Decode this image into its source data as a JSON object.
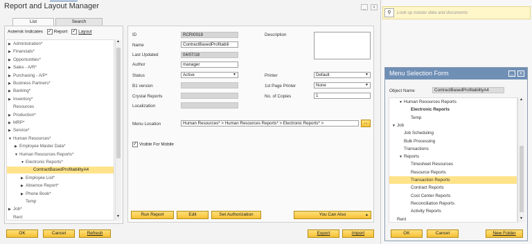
{
  "window": {
    "title": "Report and Layout Manager",
    "minimize": "_",
    "close": "x"
  },
  "tabs": [
    {
      "label": "List"
    },
    {
      "label": "Search"
    }
  ],
  "filter": {
    "label": "Asterisk Indicates",
    "report": "Report",
    "layout": "Layout"
  },
  "tree": [
    {
      "label": "Administration*",
      "level": 0,
      "arrow": "▶"
    },
    {
      "label": "Financials*",
      "level": 0,
      "arrow": "▶"
    },
    {
      "label": "Opportunities*",
      "level": 0,
      "arrow": "▶"
    },
    {
      "label": "Sales - A/R*",
      "level": 0,
      "arrow": "▶"
    },
    {
      "label": "Purchasing - A/P*",
      "level": 0,
      "arrow": "▶"
    },
    {
      "label": "Business Partners*",
      "level": 0,
      "arrow": "▶"
    },
    {
      "label": "Banking*",
      "level": 0,
      "arrow": "▶"
    },
    {
      "label": "Inventory*",
      "level": 0,
      "arrow": "▶"
    },
    {
      "label": "Resources",
      "level": 0,
      "arrow": ""
    },
    {
      "label": "Production*",
      "level": 0,
      "arrow": "▶"
    },
    {
      "label": "MRP*",
      "level": 0,
      "arrow": "▶"
    },
    {
      "label": "Service*",
      "level": 0,
      "arrow": "▶"
    },
    {
      "label": "Human Resources*",
      "level": 0,
      "arrow": "▼"
    },
    {
      "label": "Employee Master Data*",
      "level": 1,
      "arrow": "▶"
    },
    {
      "label": "Human Resources Reports*",
      "level": 1,
      "arrow": "▼"
    },
    {
      "label": "Electronic Reports*",
      "level": 2,
      "arrow": "▼"
    },
    {
      "label": "ContractBasedProfitabilityA4",
      "level": 3,
      "arrow": "",
      "selected": true
    },
    {
      "label": "Employee List*",
      "level": 2,
      "arrow": "▶"
    },
    {
      "label": "Absence Report*",
      "level": 2,
      "arrow": "▶"
    },
    {
      "label": "Phone Book*",
      "level": 2,
      "arrow": "▶"
    },
    {
      "label": "Temp",
      "level": 2,
      "arrow": ""
    },
    {
      "label": "Job*",
      "level": 0,
      "arrow": "▶"
    },
    {
      "label": "Rent",
      "level": 0,
      "arrow": ""
    }
  ],
  "form": {
    "id_label": "ID",
    "id_value": "RCRI0018",
    "name_label": "Name",
    "name_value": "ContractBasedProfitabili",
    "updated_label": "Last Updated",
    "updated_value": "04/07/18",
    "author_label": "Author",
    "author_value": "manager",
    "status_label": "Status",
    "status_value": "Active",
    "b1_label": "B1 version",
    "crystal_label": "Crystal Reports",
    "local_label": "Localization",
    "desc_label": "Description",
    "printer_label": "Printer",
    "printer_value": "Default",
    "firstpage_label": "1st Page Printer",
    "firstpage_value": "None",
    "copies_label": "No. of Copies",
    "copies_value": "1",
    "menu_label": "Menu Location",
    "menu_value": "Human Resources* > Human Resources Reports* > Electronic Reports* >",
    "menu_btn": "...",
    "visible_label": "Visible For Mobile"
  },
  "actions": {
    "run": "Run Report",
    "edit": "Edit",
    "auth": "Set Authorization",
    "youcan": "You Can Also"
  },
  "bottom": {
    "ok": "OK",
    "cancel": "Cancel",
    "refresh": "Refresh",
    "export": "Export",
    "import": "Import"
  },
  "search": {
    "placeholder": "Look up master data and documents",
    "icon": "search-icon"
  },
  "menuform": {
    "title": "Menu Selection Form",
    "min": "_",
    "close": "x",
    "objname_label": "Object Name",
    "objname_value": "ContractBasedProfitabilityA4",
    "items": [
      {
        "label": "Human Resources Reports",
        "level": 1,
        "arrow": "▼"
      },
      {
        "label": "Electronic Reports",
        "level": 2,
        "arrow": "",
        "bold": true
      },
      {
        "label": "Temp",
        "level": 2,
        "arrow": ""
      },
      {
        "label": "Job",
        "level": 0,
        "arrow": "▼"
      },
      {
        "label": "Job Scheduling",
        "level": 1,
        "arrow": ""
      },
      {
        "label": "Bulk Processing",
        "level": 1,
        "arrow": ""
      },
      {
        "label": "Transactions",
        "level": 1,
        "arrow": ""
      },
      {
        "label": "Reports",
        "level": 1,
        "arrow": "▼"
      },
      {
        "label": "Timesheet Resources",
        "level": 2,
        "arrow": ""
      },
      {
        "label": "Resource Reports",
        "level": 2,
        "arrow": ""
      },
      {
        "label": "Transaction Reports",
        "level": 2,
        "arrow": "",
        "selected": true
      },
      {
        "label": "Contract Reports",
        "level": 2,
        "arrow": ""
      },
      {
        "label": "Cost Center Reports",
        "level": 2,
        "arrow": ""
      },
      {
        "label": "Reconciliation Reports",
        "level": 2,
        "arrow": ""
      },
      {
        "label": "Activity Reports",
        "level": 2,
        "arrow": ""
      },
      {
        "label": "Rent",
        "level": 0,
        "arrow": ""
      }
    ],
    "ok": "OK",
    "cancel": "Cancel",
    "newfolder": "New Folder"
  },
  "colors": {
    "accent": "#f6c136",
    "selected": "#ffe38a",
    "header_blue": "#6f8fb5"
  }
}
